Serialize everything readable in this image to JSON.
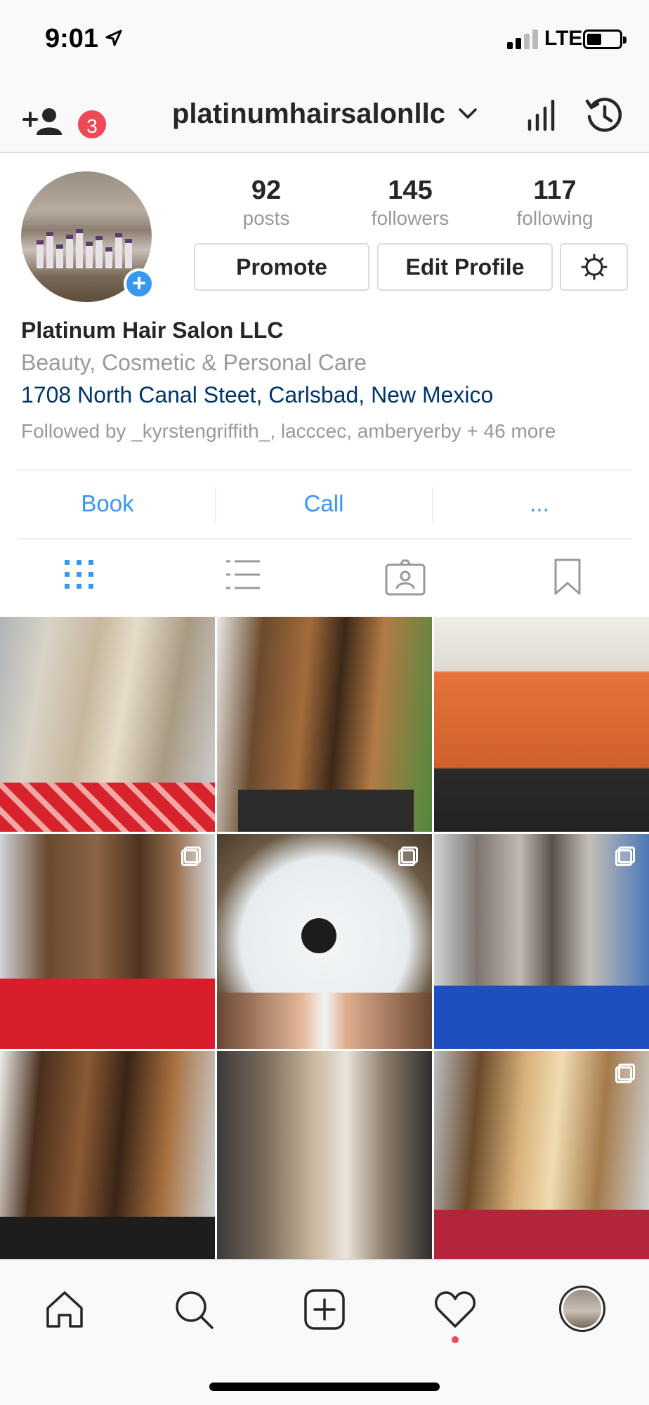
{
  "status_bar": {
    "time": "9:01",
    "network": "LTE"
  },
  "header": {
    "username": "platinumhairsalonllc",
    "notification_count": "3"
  },
  "profile": {
    "stats": [
      {
        "value": "92",
        "label": "posts"
      },
      {
        "value": "145",
        "label": "followers"
      },
      {
        "value": "117",
        "label": "following"
      }
    ],
    "buttons": {
      "promote": "Promote",
      "edit_profile": "Edit Profile"
    },
    "name": "Platinum Hair Salon LLC",
    "category": "Beauty, Cosmetic & Personal Care",
    "address": "1708 North Canal Steet, Carlsbad, New Mexico",
    "followed_by": "Followed by _kyrstengriffith_, lacccec, amberyerby + 46 more"
  },
  "actions": {
    "book": "Book",
    "call": "Call",
    "more": "..."
  },
  "profile_tabs": [
    "grid-view",
    "list-view",
    "tagged",
    "saved"
  ],
  "posts": [
    {
      "subject": "blonde-wavy-hair",
      "multiple": false
    },
    {
      "subject": "brunette-balayage",
      "multiple": false
    },
    {
      "subject": "copper-bob",
      "multiple": false
    },
    {
      "subject": "brunette-curls",
      "multiple": true
    },
    {
      "subject": "pedicure-foot-bath",
      "multiple": true
    },
    {
      "subject": "silver-balayage",
      "multiple": true
    },
    {
      "subject": "caramel-highlights",
      "multiple": false
    },
    {
      "subject": "ash-blonde-ombre",
      "multiple": false
    },
    {
      "subject": "golden-blonde-curls",
      "multiple": true
    }
  ],
  "colors": {
    "accent": "#3897f0",
    "badge": "#ed4956",
    "link": "#003569",
    "muted": "#999999"
  }
}
